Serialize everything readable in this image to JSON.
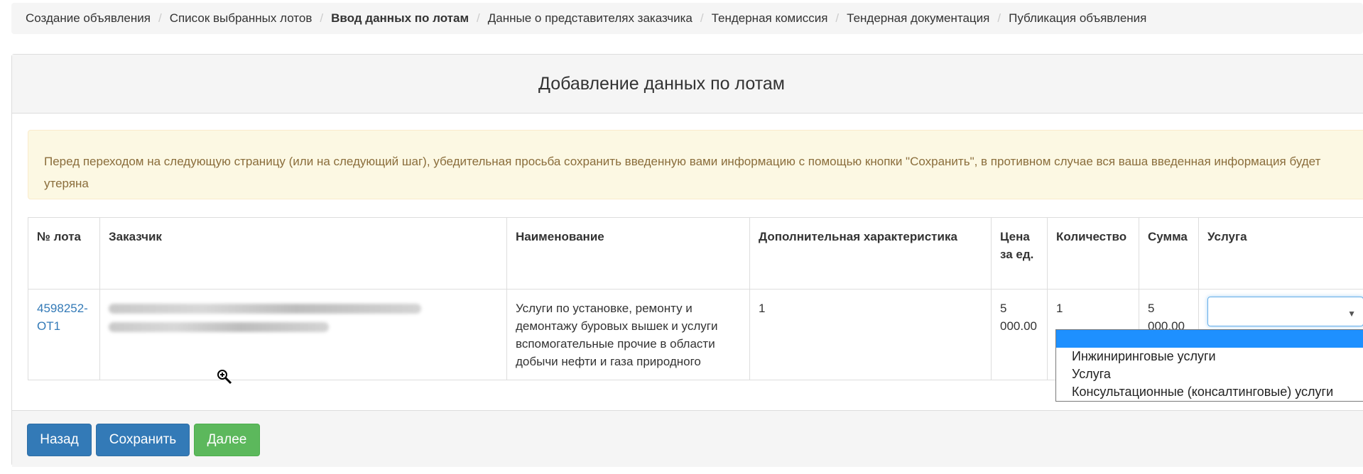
{
  "breadcrumb": [
    {
      "label": "Создание объявления",
      "active": false
    },
    {
      "label": "Список выбранных лотов",
      "active": false
    },
    {
      "label": "Ввод данных по лотам",
      "active": true
    },
    {
      "label": "Данные о представителях заказчика",
      "active": false
    },
    {
      "label": "Тендерная комиссия",
      "active": false
    },
    {
      "label": "Тендерная документация",
      "active": false
    },
    {
      "label": "Публикация объявления",
      "active": false
    }
  ],
  "breadcrumb_separator": "/",
  "panel": {
    "title": "Добавление данных по лотам",
    "alert": "Перед переходом на следующую страницу (или на следующий шаг), убедительная просьба сохранить введенную вами информацию с помощью кнопки \"Сохранить\", в противном случае вся ваша введенная информация будет утеряна"
  },
  "table": {
    "headers": {
      "lot": "№ лота",
      "customer": "Заказчик",
      "name": "Наименование",
      "extra": "Дополнительная характеристика",
      "price": "Цена за ед.",
      "qty": "Количество",
      "sum": "Сумма",
      "service": "Услуга"
    },
    "rows": [
      {
        "lot": "4598252-ОТ1",
        "customer_redacted": true,
        "name": "Услуги по установке, ремонту и демонтажу буровых вышек и услуги вспомогательные прочие в области добычи нефти и газа природного",
        "extra": "1",
        "price": "5 000.00",
        "qty": "1",
        "sum": "5 000.00",
        "service": ""
      }
    ]
  },
  "service_dropdown": {
    "arrow": "▼",
    "options": [
      "",
      "Инжиниринговые услуги",
      "Услуга",
      "Консультационные (консалтинговые) услуги"
    ],
    "highlighted_index": 0
  },
  "buttons": {
    "back": "Назад",
    "save": "Сохранить",
    "next": "Далее"
  },
  "colors": {
    "primary": "#337ab7",
    "success": "#5cb85c",
    "alert_bg": "#fcf8e3",
    "alert_text": "#8a6d3b",
    "dropdown_highlight": "#1e90ff"
  },
  "cursor_icon": "zoom-in-icon"
}
